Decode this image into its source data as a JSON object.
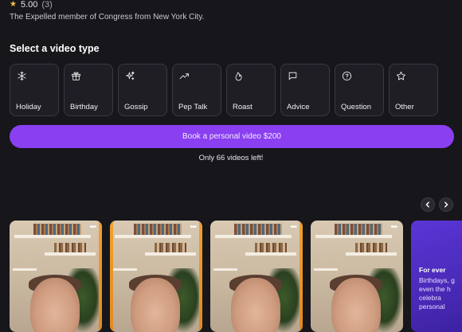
{
  "profile": {
    "rating": "5.00",
    "review_count": "(3)",
    "bio": "The Expelled member of Congress from New York City."
  },
  "section": {
    "title": "Select a video type"
  },
  "video_types": [
    {
      "label": "Holiday",
      "icon": "snowflake-icon"
    },
    {
      "label": "Birthday",
      "icon": "gift-icon"
    },
    {
      "label": "Gossip",
      "icon": "sparkles-icon"
    },
    {
      "label": "Pep Talk",
      "icon": "trending-up-icon"
    },
    {
      "label": "Roast",
      "icon": "flame-icon"
    },
    {
      "label": "Advice",
      "icon": "message-square-icon"
    },
    {
      "label": "Question",
      "icon": "help-circle-icon"
    },
    {
      "label": "Other",
      "icon": "star-icon"
    }
  ],
  "booking": {
    "button_label": "Book a personal video $200",
    "remaining": "Only 66 videos left!"
  },
  "carousel": {
    "promo_title": "For ever",
    "promo_text": "Birthdays, g\neven the h\ncelebra\npersonal"
  },
  "colors": {
    "background": "#17161b",
    "accent": "#8a3ff0",
    "card_border": "#3a3942",
    "promo": "#4a2ab8"
  }
}
